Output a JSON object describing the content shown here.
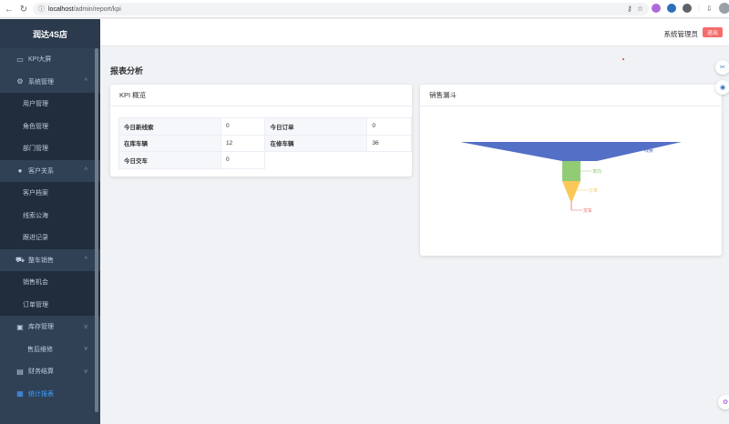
{
  "browser": {
    "host": "localhost",
    "path": "/admin/report/kpi"
  },
  "sidebar": {
    "brand": "润达4S店",
    "items": [
      {
        "label": "KPI大屏",
        "icon": "monitor-icon"
      },
      {
        "label": "系统管理",
        "icon": "gear-icon"
      },
      {
        "label": "用户管理"
      },
      {
        "label": "角色管理"
      },
      {
        "label": "部门管理"
      },
      {
        "label": "客户关系",
        "icon": "user-icon"
      },
      {
        "label": "客户档案"
      },
      {
        "label": "线索公海"
      },
      {
        "label": "跟进记录"
      },
      {
        "label": "整车销售",
        "icon": "car-icon"
      },
      {
        "label": "销售机会"
      },
      {
        "label": "订单管理"
      },
      {
        "label": "库存管理",
        "icon": "box-icon"
      },
      {
        "label": "售后维修"
      },
      {
        "label": "财务结算",
        "icon": "wallet-icon"
      },
      {
        "label": "统计报表",
        "icon": "chart-icon"
      }
    ]
  },
  "header": {
    "admin": "系统管理员",
    "logout": "退出"
  },
  "page": {
    "title": "报表分析"
  },
  "kpi": {
    "title": "KPI 概览",
    "rows": [
      [
        {
          "label": "今日新线索",
          "value": "0"
        },
        {
          "label": "今日订单",
          "value": "0"
        }
      ],
      [
        {
          "label": "在库车辆",
          "value": "12"
        },
        {
          "label": "在修车辆",
          "value": "36"
        }
      ],
      [
        {
          "label": "今日交车",
          "value": "0"
        }
      ]
    ]
  },
  "funnel": {
    "title": "销售漏斗",
    "chart_data": {
      "type": "funnel",
      "categories": [
        "线索",
        "意向",
        "订单",
        "交车"
      ],
      "colors": [
        "#5470c6",
        "#91cc75",
        "#fac858",
        "#ee6666"
      ]
    }
  }
}
